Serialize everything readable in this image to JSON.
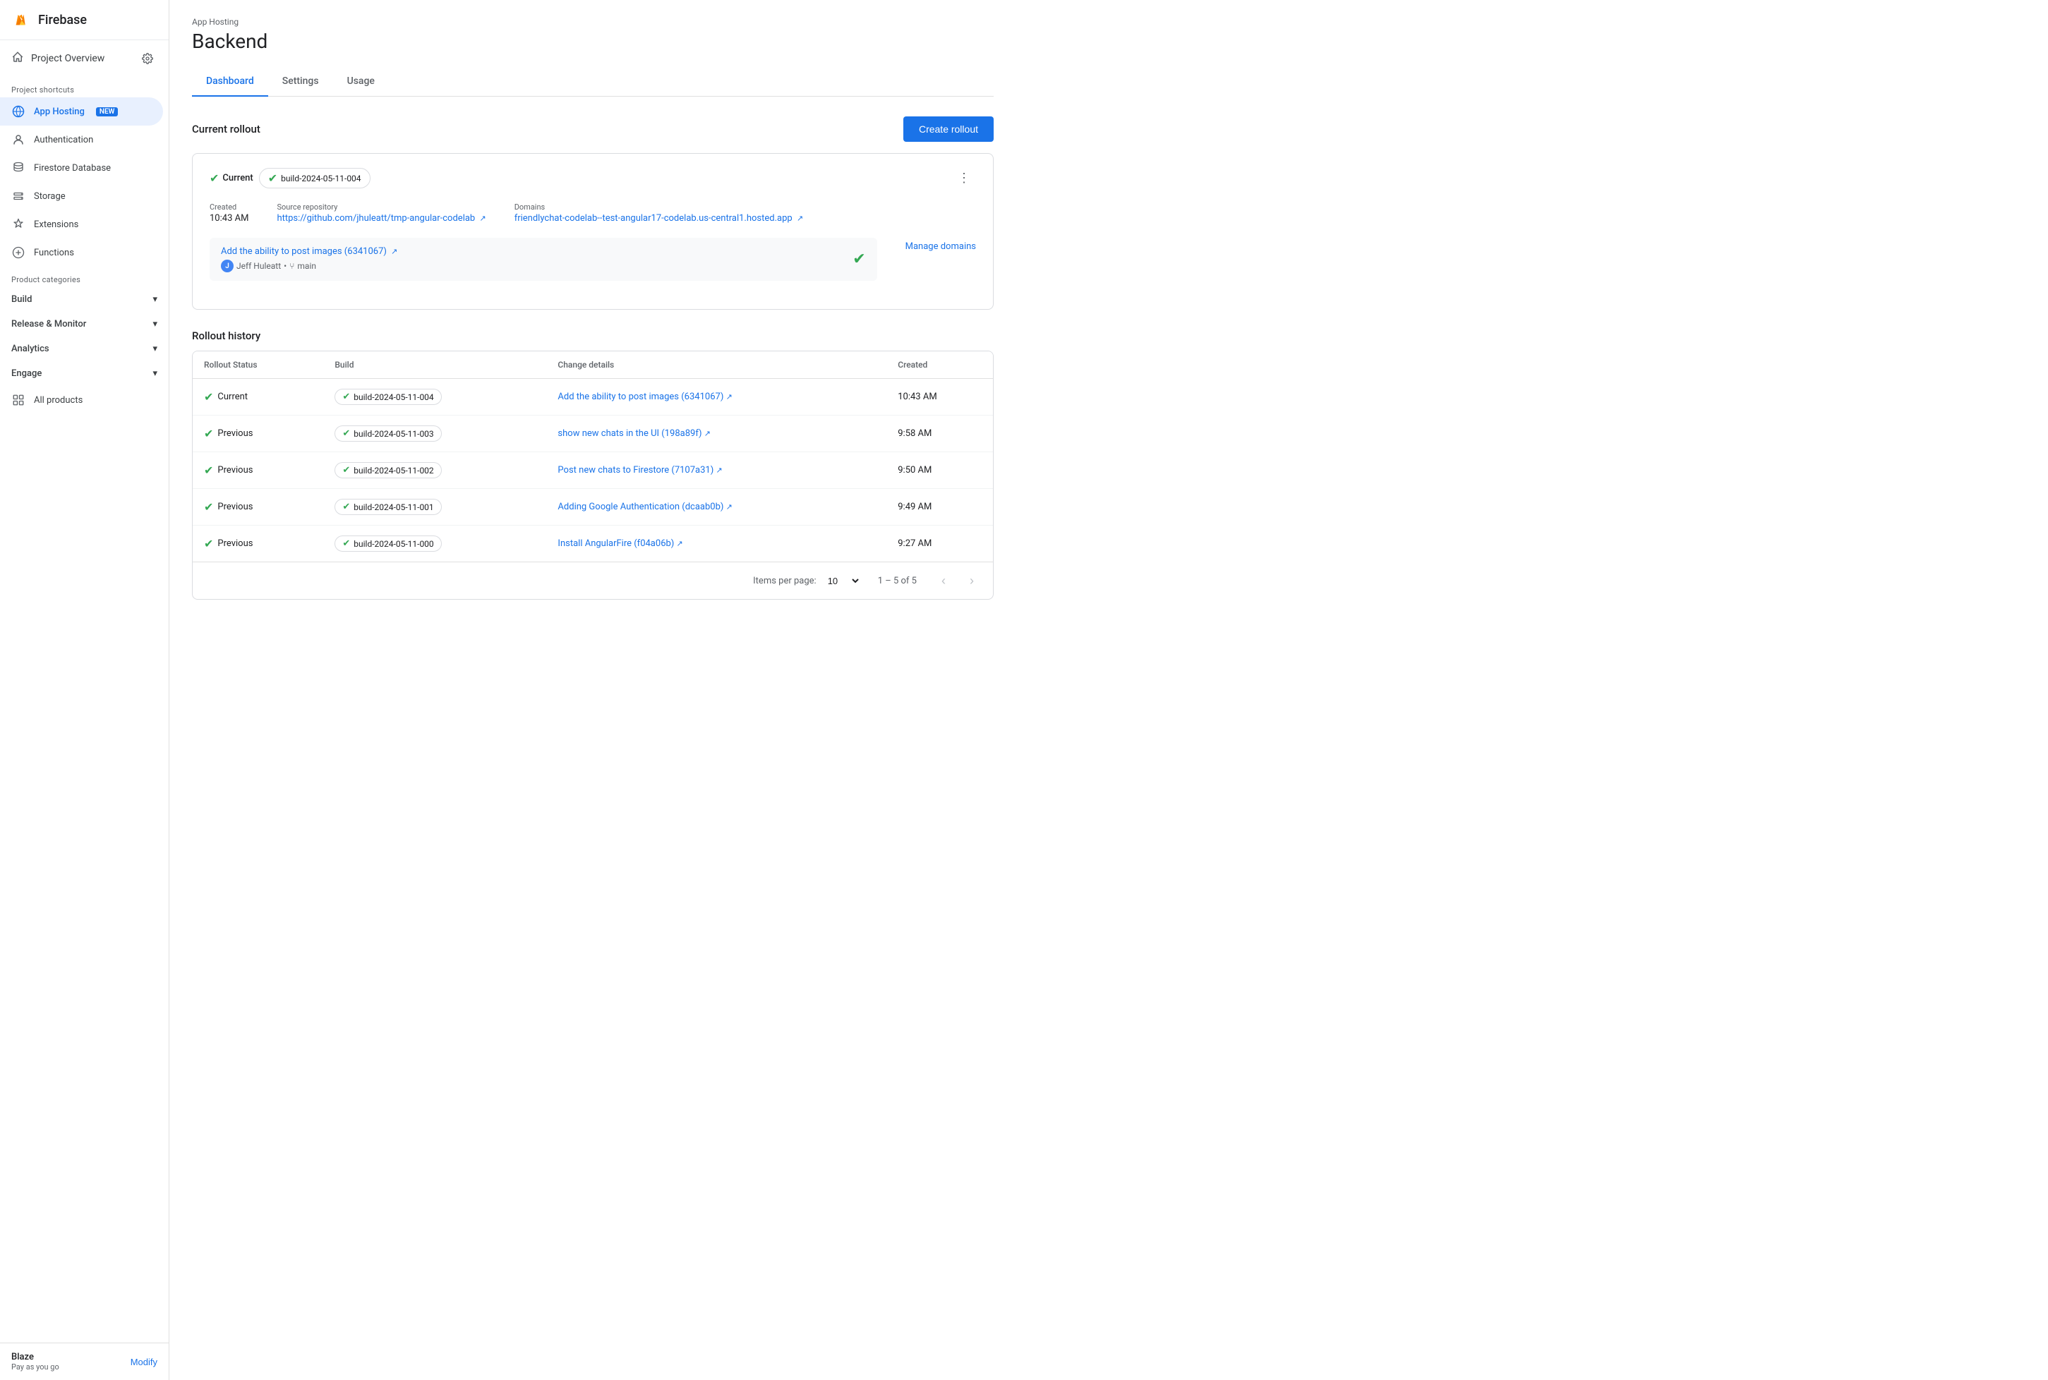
{
  "app": {
    "name": "Firebase"
  },
  "sidebar": {
    "project_overview": "Project Overview",
    "section_shortcuts": "Project shortcuts",
    "app_hosting": "App Hosting",
    "app_hosting_badge": "NEW",
    "authentication": "Authentication",
    "firestore_database": "Firestore Database",
    "storage": "Storage",
    "extensions": "Extensions",
    "functions": "Functions",
    "section_categories": "Product categories",
    "build": "Build",
    "release_monitor": "Release & Monitor",
    "analytics": "Analytics",
    "engage": "Engage",
    "all_products": "All products",
    "blaze_title": "Blaze",
    "blaze_sub": "Pay as you go",
    "modify": "Modify"
  },
  "main": {
    "breadcrumb": "App Hosting",
    "title": "Backend",
    "tabs": [
      {
        "label": "Dashboard",
        "active": true
      },
      {
        "label": "Settings",
        "active": false
      },
      {
        "label": "Usage",
        "active": false
      }
    ],
    "create_rollout_btn": "Create rollout",
    "current_rollout_section": "Current rollout",
    "rollout": {
      "status": "Current",
      "build_id": "build-2024-05-11-004",
      "created_label": "Created",
      "created_value": "10:43 AM",
      "source_label": "Source repository",
      "source_link_text": "https://github.com/jhuleatt/tmp-angular-codelab",
      "source_link_url": "#",
      "domains_label": "Domains",
      "domain_link_text": "friendlychat-codelab--test-angular17-codelab.us-central1.hosted.app",
      "domain_link_url": "#",
      "commit_title": "Add the ability to post images (6341067)",
      "commit_author": "Jeff Huleatt",
      "commit_branch": "main",
      "manage_domains": "Manage domains"
    },
    "history_section": "Rollout history",
    "table": {
      "headers": [
        "Rollout Status",
        "Build",
        "Change details",
        "Created"
      ],
      "rows": [
        {
          "status": "Current",
          "build": "build-2024-05-11-004",
          "change": "Add the ability to post images (6341067)",
          "change_url": "#",
          "created": "10:43 AM"
        },
        {
          "status": "Previous",
          "build": "build-2024-05-11-003",
          "change": "show new chats in the UI (198a89f)",
          "change_url": "#",
          "created": "9:58 AM"
        },
        {
          "status": "Previous",
          "build": "build-2024-05-11-002",
          "change": "Post new chats to Firestore (7107a31)",
          "change_url": "#",
          "created": "9:50 AM"
        },
        {
          "status": "Previous",
          "build": "build-2024-05-11-001",
          "change": "Adding Google Authentication (dcaab0b)",
          "change_url": "#",
          "created": "9:49 AM"
        },
        {
          "status": "Previous",
          "build": "build-2024-05-11-000",
          "change": "Install AngularFire (f04a06b)",
          "change_url": "#",
          "created": "9:27 AM"
        }
      ],
      "items_per_page_label": "Items per page:",
      "items_per_page_value": "10",
      "pagination_text": "1 – 5 of 5"
    }
  }
}
